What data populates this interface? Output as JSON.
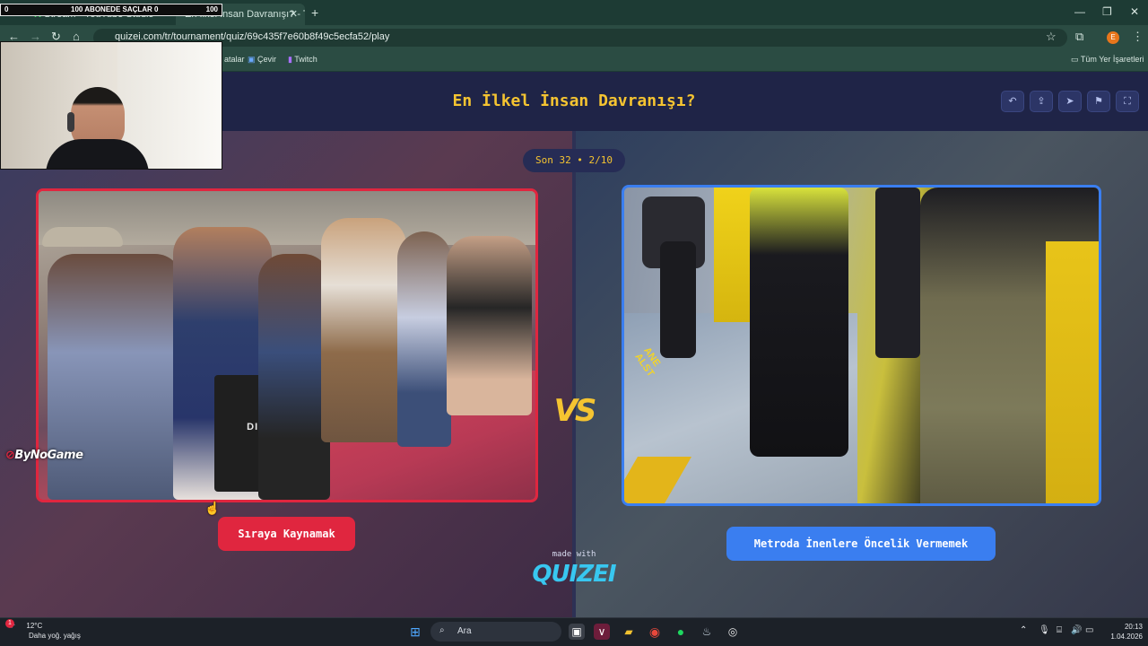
{
  "browser": {
    "tabs": [
      {
        "label": "Stream - YouTube Studio"
      },
      {
        "label": "En İlkel İnsan Davranışı? - Tier l"
      }
    ],
    "new_tab_icon": "plus-icon",
    "url": "quizei.com/tr/tournament/quiz/69c435f7e60b8f49c5ecfa52/play",
    "bookmarks": [
      {
        "label": "Çevir"
      },
      {
        "label": "Twitch"
      }
    ],
    "bookmarks_partial_label": "atalar",
    "all_bookmarks_label": "Tüm Yer İşaretleri",
    "profile_initial": "E"
  },
  "overlay": {
    "banner_left": "0",
    "banner_text": "100 ABONEDE SAÇLAR 0",
    "banner_right": "100",
    "watermark": "ByNoGame"
  },
  "quiz": {
    "title": "En İlkel İnsan Davranışı?",
    "round_info": "Son 32 • 2/10",
    "vs_label": "VS",
    "left_choice": "Sıraya Kaynamak",
    "right_choice": "Metroda İnenlere Öncelik Vermemek",
    "bag_text": "DIESEL",
    "platform_text": "ANE ALST",
    "made_with": "made with",
    "brand": "QUIZEI",
    "accent_left": "#e0263f",
    "accent_right": "#3a7ef0",
    "title_color": "#f5c431"
  },
  "taskbar": {
    "weather_temp": "12°C",
    "weather_desc": "Daha yoğ. yağış",
    "search_placeholder": "Ara",
    "time": "20:13",
    "date": "1.04.2026",
    "notification_count": "1"
  }
}
